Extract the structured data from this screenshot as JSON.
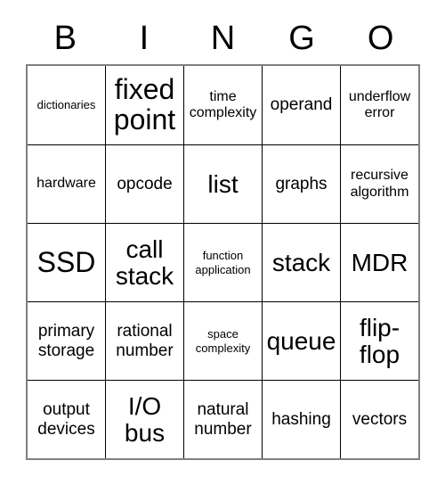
{
  "card": {
    "header": {
      "letters": [
        "B",
        "I",
        "N",
        "G",
        "O"
      ]
    },
    "colors": {
      "text": "#000000",
      "cell_border": "#000000",
      "outer_border": "#808080",
      "background": "#ffffff"
    },
    "grid": {
      "columns": 5,
      "rows": 5,
      "cells": [
        [
          {
            "label": "dictionaries",
            "size": "xs"
          },
          {
            "label": "fixed point",
            "size": "xxl"
          },
          {
            "label": "time complexity",
            "size": "sm"
          },
          {
            "label": "operand",
            "size": "md"
          },
          {
            "label": "underflow error",
            "size": "sm"
          }
        ],
        [
          {
            "label": "hardware",
            "size": "sm"
          },
          {
            "label": "opcode",
            "size": "md"
          },
          {
            "label": "list",
            "size": "xl"
          },
          {
            "label": "graphs",
            "size": "md"
          },
          {
            "label": "recursive algorithm",
            "size": "sm"
          }
        ],
        [
          {
            "label": "SSD",
            "size": "xxl"
          },
          {
            "label": "call stack",
            "size": "xl"
          },
          {
            "label": "function application",
            "size": "xs"
          },
          {
            "label": "stack",
            "size": "xl"
          },
          {
            "label": "MDR",
            "size": "xl"
          }
        ],
        [
          {
            "label": "primary storage",
            "size": "md"
          },
          {
            "label": "rational number",
            "size": "md"
          },
          {
            "label": "space complexity",
            "size": "xs"
          },
          {
            "label": "queue",
            "size": "xl"
          },
          {
            "label": "flip-flop",
            "size": "xl"
          }
        ],
        [
          {
            "label": "output devices",
            "size": "md"
          },
          {
            "label": "I/O bus",
            "size": "xl"
          },
          {
            "label": "natural number",
            "size": "md"
          },
          {
            "label": "hashing",
            "size": "md"
          },
          {
            "label": "vectors",
            "size": "md"
          }
        ]
      ]
    }
  }
}
